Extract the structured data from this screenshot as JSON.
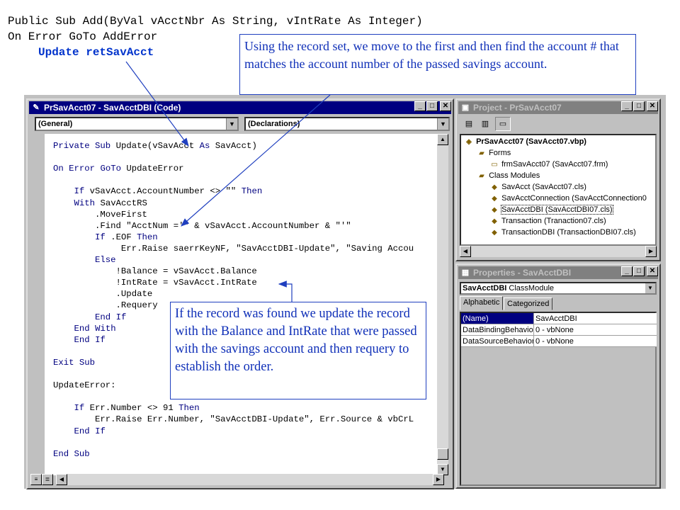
{
  "slide": {
    "code_line1": "Public Sub Add(ByVal vAcctNbr As String, vIntRate As Integer)",
    "code_line2": "On Error GoTo AddError",
    "code_line3": "Update retSavAcct",
    "callout_top": "Using the record set, we move to the first and then find the account # that matches the account number of the passed savings account.",
    "callout_mid": "If the record was found we update the record with the Balance and IntRate that were passed with the savings account and then requery to establish the order."
  },
  "code_window": {
    "title": "PrSavAcct07 - SavAcctDBI (Code)",
    "object_combo": "(General)",
    "proc_combo": "(Declarations)",
    "lines": [
      "Private Sub Update(vSavAcct As SavAcct)",
      "",
      "On Error GoTo UpdateError",
      "",
      "    If vSavAcct.AccountNumber <> \"\" Then",
      "    With SavAcctRS",
      "        .MoveFirst",
      "        .Find \"AcctNum ='\" & vSavAcct.AccountNumber & \"'\"",
      "        If .EOF Then",
      "             Err.Raise saerrKeyNF, \"SavAcctDBI-Update\", \"Saving Accou",
      "        Else",
      "            !Balance = vSavAcct.Balance",
      "            !IntRate = vSavAcct.IntRate",
      "            .Update",
      "            .Requery",
      "        End If",
      "    End With",
      "    End If",
      "",
      "Exit Sub",
      "",
      "UpdateError:",
      "",
      "    If Err.Number <> 91 Then",
      "        Err.Raise Err.Number, \"SavAcctDBI-Update\", Err.Source & vbCrL",
      "    End If",
      "",
      "End Sub"
    ]
  },
  "project_window": {
    "title": "Project - PrSavAcct07",
    "tree": [
      {
        "label": "PrSavAcct07 (SavAcct07.vbp)",
        "icon": "project-icon"
      },
      {
        "label": "Forms",
        "icon": "folder-icon"
      },
      {
        "label": "frmSavAcct07 (SavAcct07.frm)",
        "icon": "form-icon"
      },
      {
        "label": "Class Modules",
        "icon": "folder-icon"
      },
      {
        "label": "SavAcct (SavAcct07.cls)",
        "icon": "class-icon"
      },
      {
        "label": "SavAcctConnection (SavAcctConnection0",
        "icon": "class-icon"
      },
      {
        "label": "SavAcctDBI (SavAcctDBI07.cls)",
        "icon": "class-icon"
      },
      {
        "label": "Transaction (Tranaction07.cls)",
        "icon": "class-icon"
      },
      {
        "label": "TransactionDBI (TransactionDBI07.cls)",
        "icon": "class-icon"
      }
    ]
  },
  "properties_window": {
    "title": "Properties - SavAcctDBI",
    "object_name": "SavAcctDBI",
    "object_type": "ClassModule",
    "tabs": [
      "Alphabetic",
      "Categorized"
    ],
    "rows": [
      {
        "name": "(Name)",
        "value": "SavAcctDBI"
      },
      {
        "name": "DataBindingBehavior",
        "value": "0 - vbNone"
      },
      {
        "name": "DataSourceBehavior",
        "value": "0 - vbNone"
      }
    ]
  },
  "colors": {
    "titlebar_active": "#000080",
    "callout_text": "#1030b8",
    "keyword": "#000080"
  }
}
